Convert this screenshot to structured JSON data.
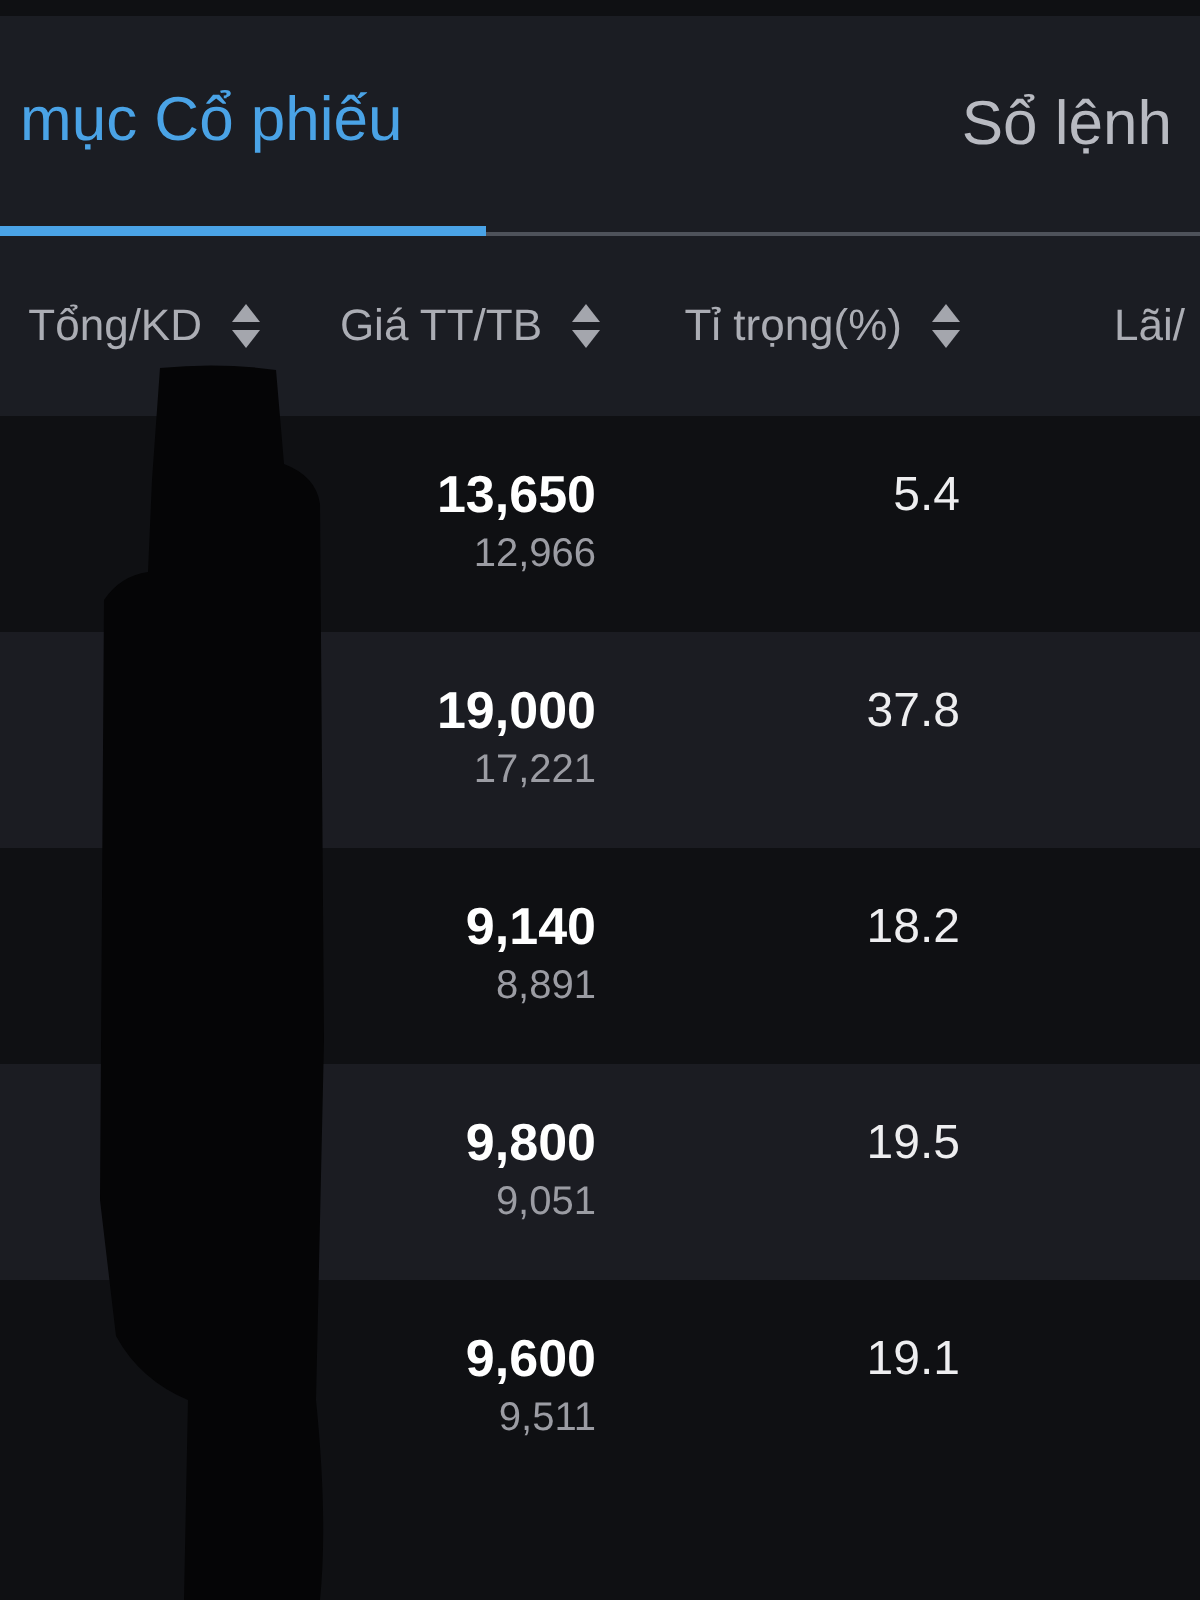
{
  "tabs": [
    {
      "label": "mục Cổ phiếu",
      "selected": true
    },
    {
      "label": "Sổ lệnh",
      "selected": false
    }
  ],
  "table": {
    "columns": [
      {
        "label": "Tổng/KD",
        "sortable": true
      },
      {
        "label": "Giá TT/TB",
        "sortable": true
      },
      {
        "label": "Tỉ trọng(%)",
        "sortable": true
      },
      {
        "label": "Lãi/",
        "sortable": false
      }
    ],
    "rows": [
      {
        "price": "13,650",
        "avg_price": "12,966",
        "weight": "5.4"
      },
      {
        "price": "19,000",
        "avg_price": "17,221",
        "weight": "37.8"
      },
      {
        "price": "9,140",
        "avg_price": "8,891",
        "weight": "18.2"
      },
      {
        "price": "9,800",
        "avg_price": "9,051",
        "weight": "19.5"
      },
      {
        "price": "9,600",
        "avg_price": "9,511",
        "weight": "19.1"
      }
    ]
  }
}
